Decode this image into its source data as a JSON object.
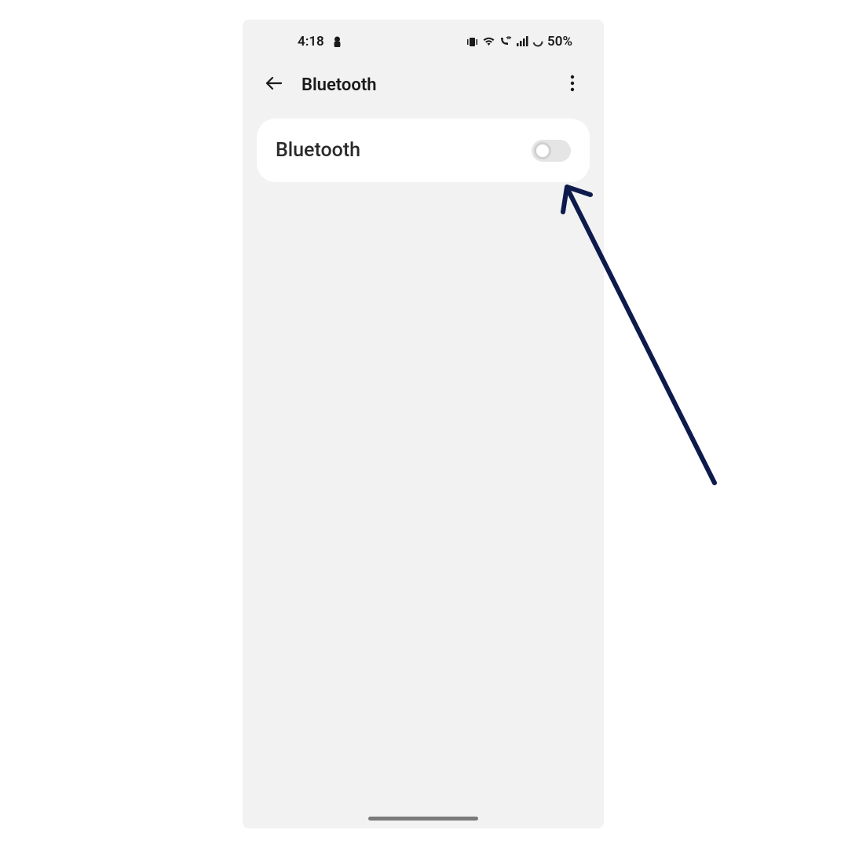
{
  "status_bar": {
    "time": "4:18",
    "battery_text": "50%"
  },
  "app_bar": {
    "title": "Bluetooth"
  },
  "main": {
    "bluetooth_label": "Bluetooth",
    "bluetooth_enabled": false
  }
}
